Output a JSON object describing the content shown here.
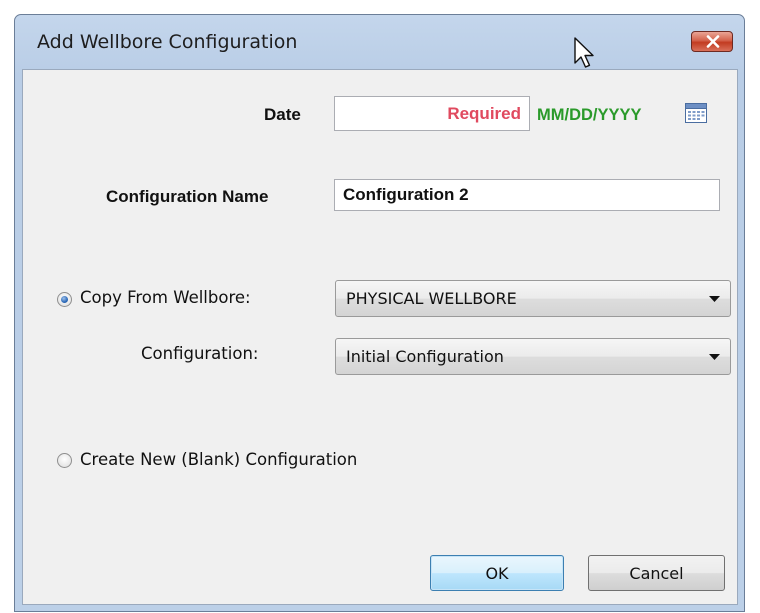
{
  "window": {
    "title": "Add Wellbore Configuration"
  },
  "form": {
    "date_label": "Date",
    "date_value": "Required",
    "date_format": "MM/DD/YYYY",
    "config_name_label": "Configuration Name",
    "config_name_value": "Configuration 2",
    "copy_from_label": "Copy From Wellbore:",
    "copy_from_selected": true,
    "wellbore_value": "PHYSICAL WELLBORE",
    "configuration_label": "Configuration:",
    "configuration_value": "Initial Configuration",
    "create_new_label": "Create New (Blank) Configuration",
    "create_new_selected": false
  },
  "buttons": {
    "ok_label": "OK",
    "cancel_label": "Cancel"
  },
  "icons": {
    "close": "close-icon",
    "calendar": "calendar-icon",
    "dropdown": "chevron-down-icon",
    "cursor": "mouse-pointer-icon"
  },
  "colors": {
    "required_text": "#e04a5f",
    "date_format_text": "#2a9a2a",
    "close_button": "#c23b21",
    "default_button_border": "#3c7fb1"
  }
}
